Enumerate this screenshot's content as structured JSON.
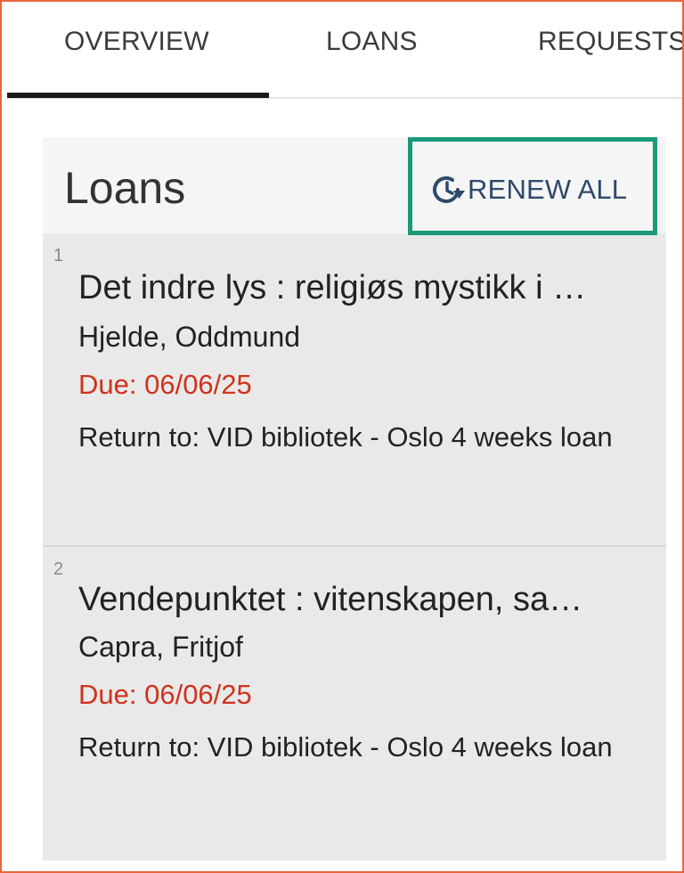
{
  "tabs": {
    "items": [
      {
        "label": "OVERVIEW",
        "active": true
      },
      {
        "label": "LOANS",
        "active": false
      },
      {
        "label": "REQUESTS",
        "active": false
      }
    ]
  },
  "loans_panel": {
    "title": "Loans",
    "renew_all_label": "RENEW ALL",
    "renew_icon": "clock-renew-icon",
    "items": [
      {
        "index": "1",
        "title": "Det indre lys : religiøs mystikk i …",
        "author": "Hjelde, Oddmund",
        "due": "Due: 06/06/25",
        "return_to": "Return to: VID bibliotek - Oslo 4 weeks loan"
      },
      {
        "index": "2",
        "title": "Vendepunktet : vitenskapen, sa…",
        "author": "Capra, Fritjof",
        "due": "Due: 06/06/25",
        "return_to": "Return to: VID bibliotek - Oslo 4 weeks loan"
      }
    ]
  },
  "colors": {
    "due_text": "#d0321c",
    "highlight_border": "#1a9a7a",
    "renew_text": "#2d4a6b",
    "frame_border": "#e8663f"
  }
}
